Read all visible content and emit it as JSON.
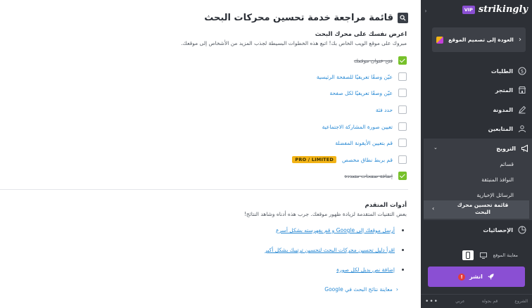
{
  "main": {
    "title": "قائمة مراجعة خدمة تحسين محركات البحث",
    "section": {
      "title": "اعرض نفسك على محرك البحث",
      "description": "مبروك على موقع الويب الخاص بك! اتبع هذه الخطوات البسيطة لجذب المزيد من الأشخاص إلى موقعك."
    },
    "tasks": [
      {
        "label": "فتح عنوان موقعك",
        "done": true
      },
      {
        "label": "عيّن وصفًا تعريفيًا للصفحة الرئيسية",
        "done": false
      },
      {
        "label": "عيّن وصفًا تعريفيًا لكل صفحة",
        "done": false
      },
      {
        "label": "حدد فئة",
        "done": false
      },
      {
        "label": "تعيين صورة المشاركة الاجتماعية",
        "done": false
      },
      {
        "label": "قم بتعيين الأيقونة المفضلة",
        "done": false
      },
      {
        "label": "قم بربط نطاق مخصص",
        "done": false,
        "badge": "PRO / LIMITED"
      },
      {
        "label": "إضافة صفحات متعددة",
        "done": true
      }
    ],
    "advanced": {
      "title": "أدوات المتقدم",
      "description": "بعض التقنيات المتقدمة لزيادة ظهور موقعك. جرب هذه أدناه وشاهد النتائج!",
      "links": [
        "أرسل موقعك إلى Google و قم بفهرسته بشكل أسرع",
        "اقرأ دليل تحسين محركات البحث لتحسين ترتيبك بشكل أكبر",
        "إضافة نص بديل لكل صورة"
      ],
      "preview_link": "معاينة نتائج البحث في Google"
    }
  },
  "sidebar": {
    "logo": "strikingly",
    "vip": "VIP",
    "back_label": "العودة إلى تصميم الموقع",
    "nav": [
      {
        "label": "الطلبات",
        "icon": "dollar-icon"
      },
      {
        "label": "المتجر",
        "icon": "store-icon"
      },
      {
        "label": "المدونة",
        "icon": "pen-icon"
      },
      {
        "label": "المتابعين",
        "icon": "users-icon"
      }
    ],
    "promotion": {
      "label": "الترويج",
      "icon": "megaphone-icon",
      "items": [
        "قسائم",
        "النوافذ المنبثقة",
        "الرسائل الإخبارية"
      ],
      "active_item": "قائمة تحسين محرك البحث"
    },
    "stats": {
      "label": "الإحصائيات",
      "icon": "chart-icon"
    },
    "preview_label": "معاينة الموقع",
    "publish_label": "انشر",
    "bottom": [
      "الشروع",
      "قم بجولة",
      "عربي"
    ]
  },
  "colors": {
    "accent": "#8a4fd3",
    "link": "#2a8ad4",
    "done": "#77c12a",
    "badge": "#f2b316",
    "sidebar_bg": "#2d3036"
  }
}
